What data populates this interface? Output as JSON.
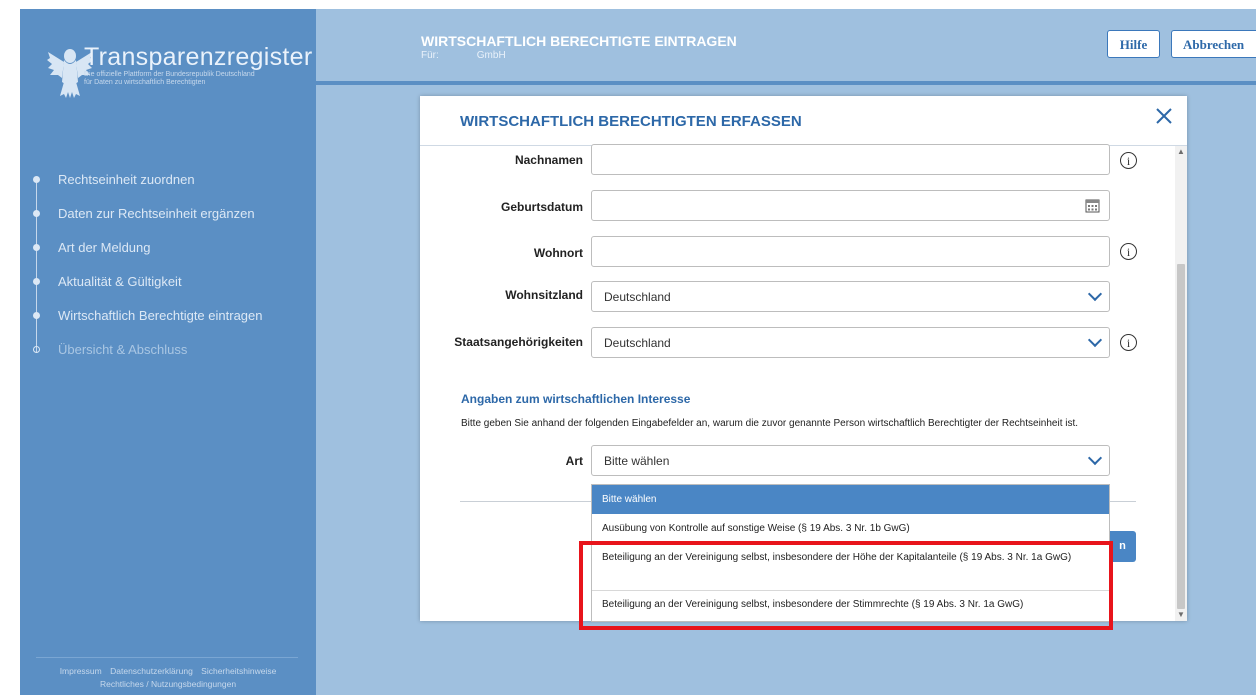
{
  "sidebar": {
    "logo_title": "Transparenzregister",
    "logo_subtitle_1": "Die offizielle Plattform der Bundesrepublik Deutschland",
    "logo_subtitle_2": "für Daten zu wirtschaftlich Berechtigten",
    "steps": [
      {
        "label": "Rechtseinheit zuordnen"
      },
      {
        "label": "Daten zur Rechtseinheit ergänzen"
      },
      {
        "label": "Art der Meldung"
      },
      {
        "label": "Aktualität & Gültigkeit"
      },
      {
        "label": "Wirtschaftlich Berechtigte eintragen"
      },
      {
        "label": "Übersicht & Abschluss"
      }
    ],
    "footer": {
      "impressum": "Impressum",
      "datenschutz": "Datenschutzerklärung",
      "sicherheit": "Sicherheitshinweise",
      "rechtliches": "Rechtliches / Nutzungsbedingungen"
    }
  },
  "header": {
    "title": "WIRTSCHAFTLICH BERECHTIGTE EINTRAGEN",
    "fuer_label": "Für:",
    "fuer_value": "GmbH",
    "help_label": "Hilfe",
    "cancel_label": "Abbrechen"
  },
  "modal": {
    "title": "WIRTSCHAFTLICH BERECHTIGTEN ERFASSEN",
    "fields": {
      "nachnamen": {
        "label": "Nachnamen",
        "value": ""
      },
      "geburtsdatum": {
        "label": "Geburtsdatum",
        "value": ""
      },
      "wohnort": {
        "label": "Wohnort",
        "value": ""
      },
      "wohnsitzland": {
        "label": "Wohnsitzland",
        "value": "Deutschland"
      },
      "staatsangehoerigkeiten": {
        "label": "Staatsangehörigkeiten",
        "value": "Deutschland"
      }
    },
    "section_heading": "Angaben zum wirtschaftlichen Interesse",
    "section_description": "Bitte geben Sie anhand der folgenden Eingabefelder an, warum die zuvor genannte Person wirtschaftlich Berechtigter der Rechtseinheit ist.",
    "art": {
      "label": "Art",
      "value": "Bitte wählen",
      "options": [
        "Bitte wählen",
        "Ausübung von Kontrolle auf sonstige Weise (§ 19 Abs. 3 Nr. 1b GwG)",
        "Beteiligung an der Vereinigung selbst, insbesondere der Höhe der Kapitalanteile (§ 19 Abs. 3 Nr. 1a GwG)",
        "Beteiligung an der Vereinigung selbst, insbesondere der Stimmrechte (§ 19 Abs. 3 Nr. 1a GwG)"
      ]
    },
    "hidden_button_tail": "n"
  },
  "colors": {
    "sidebar_bg": "#5b8fc4",
    "content_bg": "#9fc0df",
    "accent": "#2d68a8",
    "highlight": "#e8141b"
  }
}
